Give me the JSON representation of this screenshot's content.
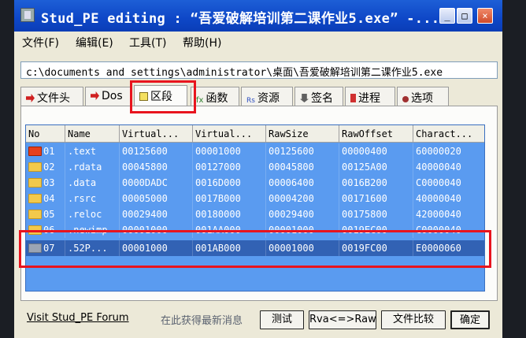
{
  "window": {
    "title": "Stud_PE editing : “吾爱破解培训第二课作业5.exe” -..."
  },
  "titlebar_buttons": [
    "_",
    "□",
    "×"
  ],
  "menu": [
    {
      "label": "文件(F)"
    },
    {
      "label": "编辑(E)"
    },
    {
      "label": "工具(T)"
    },
    {
      "label": "帮助(H)"
    }
  ],
  "path": "c:\\documents and settings\\administrator\\桌面\\吾爱破解培训第二课作业5.exe",
  "tabs": [
    {
      "label": "文件头",
      "icon": "red-arrow-icon",
      "color": "#d02020"
    },
    {
      "label": "Dos",
      "icon": "red-arrow-icon",
      "color": "#d02020"
    },
    {
      "label": "区段",
      "icon": "section-icon",
      "color": "#e0c020",
      "active": true
    },
    {
      "label": "函数",
      "icon": "fx-icon",
      "color": "#308030"
    },
    {
      "label": "资源",
      "icon": "rs-icon",
      "color": "#3050c0"
    },
    {
      "label": "签名",
      "icon": "signature-icon",
      "color": "#404040"
    },
    {
      "label": "进程",
      "icon": "process-icon",
      "color": "#d03030"
    },
    {
      "label": "选项",
      "icon": "options-icon",
      "color": "#a03030"
    }
  ],
  "table": {
    "columns": [
      "No",
      "Name",
      "Virtual...",
      "Virtual...",
      "RawSize",
      "RawOffset",
      "Charact..."
    ],
    "rows": [
      {
        "icon_text": "ep",
        "no": "01",
        "name": ".text",
        "vsize": "00125600",
        "vaddr": "00001000",
        "rawsize": "00125600",
        "rawoffset": "00000400",
        "charact": "60000020"
      },
      {
        "no": "02",
        "name": ".rdata",
        "vsize": "00045800",
        "vaddr": "00127000",
        "rawsize": "00045800",
        "rawoffset": "00125A00",
        "charact": "40000040"
      },
      {
        "no": "03",
        "name": ".data",
        "vsize": "0000DADC",
        "vaddr": "0016D000",
        "rawsize": "00006400",
        "rawoffset": "0016B200",
        "charact": "C0000040"
      },
      {
        "no": "04",
        "name": ".rsrc",
        "vsize": "00005000",
        "vaddr": "0017B000",
        "rawsize": "00004200",
        "rawoffset": "00171600",
        "charact": "40000040"
      },
      {
        "no": "05",
        "name": ".reloc",
        "vsize": "00029400",
        "vaddr": "00180000",
        "rawsize": "00029400",
        "rawoffset": "00175800",
        "charact": "42000040"
      },
      {
        "no": "06",
        "name": ".newimp",
        "vsize": "00001000",
        "vaddr": "001AA000",
        "rawsize": "00001000",
        "rawoffset": "0019EC00",
        "charact": "C0000040"
      },
      {
        "no": "07",
        "name": ".52P...",
        "vsize": "00001000",
        "vaddr": "001AB000",
        "rawsize": "00001000",
        "rawoffset": "0019FC00",
        "charact": "E0000060",
        "selected": true
      }
    ]
  },
  "footer": {
    "forum_link": "Visit Stud_PE Forum",
    "status": "在此获得最新消息",
    "buttons": [
      {
        "label": "测试"
      },
      {
        "label": "Rva<=>Raw"
      },
      {
        "label": "文件比较"
      },
      {
        "label": "确定"
      }
    ]
  },
  "colors": {
    "highlight": "#e8141e",
    "grid_bg": "#5a9bf0",
    "selection": "#3262b4",
    "titlebar": "#0e47c7"
  }
}
